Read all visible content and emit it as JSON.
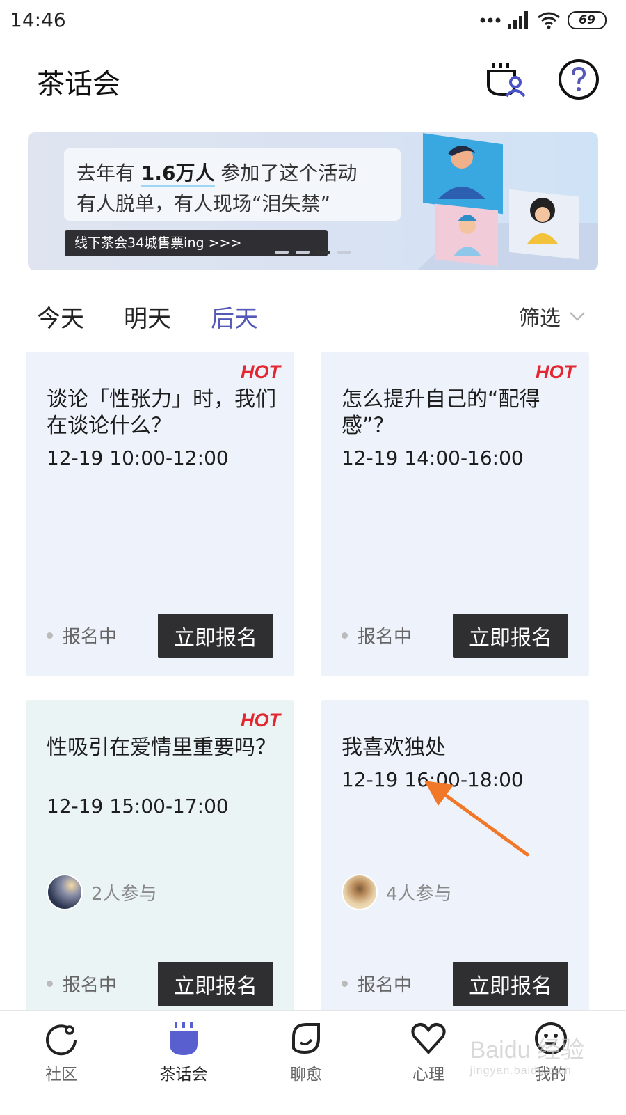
{
  "statusbar": {
    "time": "14:46",
    "battery": "69"
  },
  "header": {
    "title": "茶话会",
    "icons": [
      "tea-user-icon",
      "help-icon"
    ]
  },
  "banner": {
    "line1_pre": "去年有 ",
    "line1_bold": "1.6万人",
    "line1_post": " 参加了这个活动",
    "line2": "有人脱单，有人现场“泪失禁”",
    "pill": "线下茶会34城售票ing >>>",
    "active_slide": 3,
    "slide_count": 4
  },
  "tabs": [
    {
      "label": "今天"
    },
    {
      "label": "明天"
    },
    {
      "label": "后天",
      "active": true
    }
  ],
  "filter_label": "筛选",
  "cards": [
    {
      "hot": "HOT",
      "title": "谈论「性张力」时，我们在谈论什么？",
      "time": "12-19 10:00-12:00",
      "status": "报名中",
      "button": "立即报名"
    },
    {
      "hot": "HOT",
      "title": "怎么提升自己的“配得感”？",
      "time": "12-19 14:00-16:00",
      "status": "报名中",
      "button": "立即报名"
    },
    {
      "hot": "HOT",
      "title": "性吸引在爱情里重要吗？",
      "time": "12-19 15:00-17:00",
      "participants": "2人参与",
      "status": "报名中",
      "button": "立即报名"
    },
    {
      "title": "我喜欢独处",
      "time": "12-19 16:00-18:00",
      "participants": "4人参与",
      "status": "报名中",
      "button": "立即报名"
    }
  ],
  "bottom_nav": [
    {
      "label": "社区",
      "icon": "community-icon"
    },
    {
      "label": "茶话会",
      "icon": "tea-party-icon",
      "active": true
    },
    {
      "label": "聊愈",
      "icon": "chat-heal-icon"
    },
    {
      "label": "心理",
      "icon": "heart-icon"
    },
    {
      "label": "我的",
      "icon": "profile-icon"
    }
  ],
  "watermark": {
    "main": "Baidu 经验",
    "sub": "jingyan.baidu.com"
  },
  "colors": {
    "accent": "#5458b8",
    "hot": "#e3262f",
    "button": "#2f2f31"
  }
}
